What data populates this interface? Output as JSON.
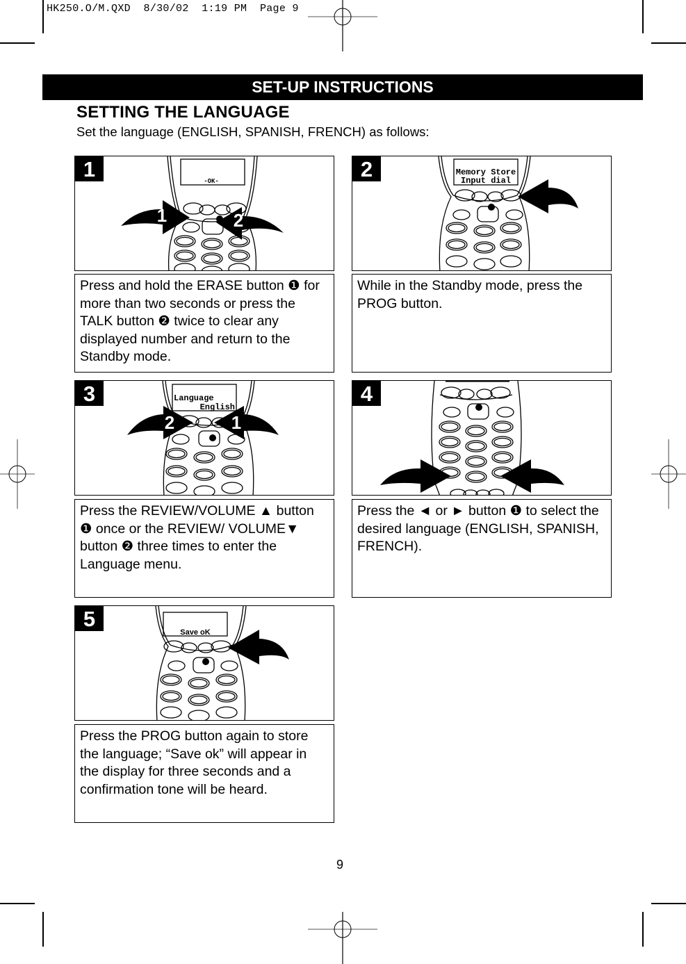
{
  "slug": "HK250.O/M.QXD  8/30/02  1:19 PM  Page 9",
  "banner": "SET-UP INSTRUCTIONS",
  "section_title": "SETTING THE LANGUAGE",
  "intro": "Set the language (ENGLISH, SPANISH, FRENCH) as follows:",
  "steps": [
    {
      "number": "1",
      "display": [
        "",
        "-OK-"
      ],
      "callouts": [
        "1",
        "2"
      ],
      "text": "Press and hold the ERASE button ❶ for more than two seconds or press the TALK button ❷ twice to clear any displayed number and return to the Standby mode."
    },
    {
      "number": "2",
      "display": [
        "Memory Store",
        "Input dial"
      ],
      "callouts": [],
      "text": "While in the Standby mode, press the PROG button."
    },
    {
      "number": "3",
      "display": [
        "Language",
        "English"
      ],
      "callouts": [
        "2",
        "1"
      ],
      "text": "Press the REVIEW/VOLUME ▲ button ❶ once or the REVIEW/ VOLUME▼ button ❷ three times to enter the Language menu."
    },
    {
      "number": "4",
      "display": [],
      "callouts": [],
      "text": "Press the ◄ or ► button ❶  to select the desired language (ENGLISH, SPANISH, FRENCH)."
    },
    {
      "number": "5",
      "display": [
        "",
        "Save oK"
      ],
      "callouts": [],
      "text": "Press the PROG button again to store the language; “Save ok” will appear in the display for three seconds and a confirmation tone will be heard."
    }
  ],
  "page_number": "9"
}
